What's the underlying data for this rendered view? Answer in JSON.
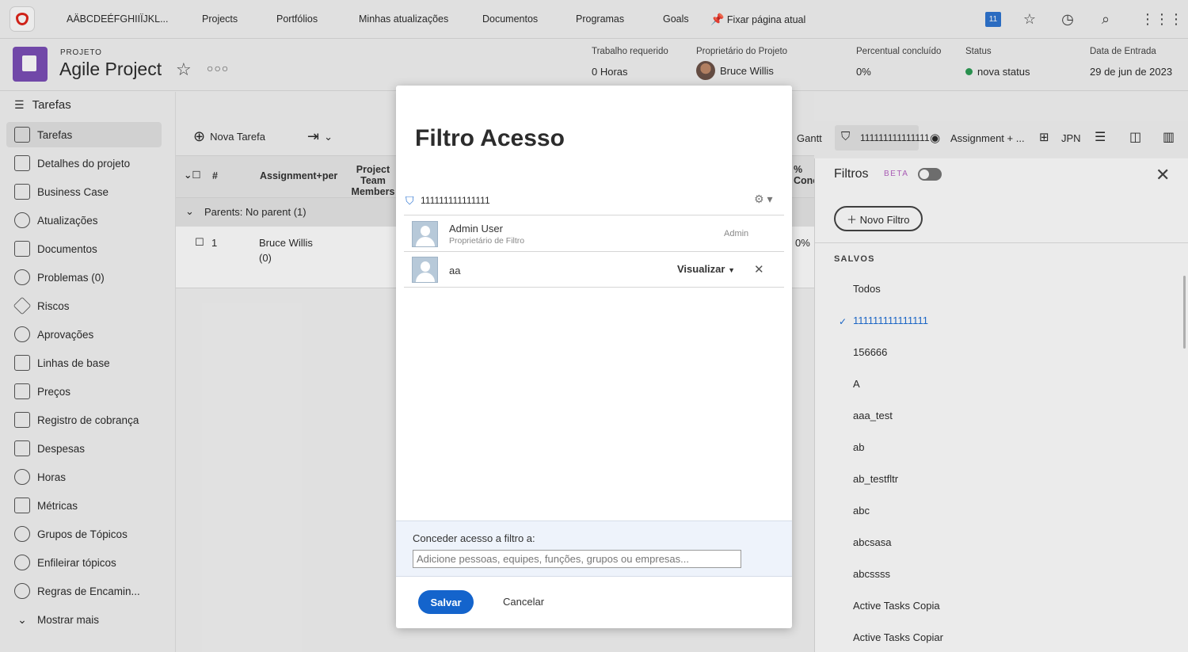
{
  "topnav": {
    "account": "AÄBCDEÉFGHIIÏJKL...",
    "items": [
      "Projects",
      "Portfólios",
      "Minhas atualizações",
      "Documentos",
      "Programas",
      "Goals"
    ],
    "pin_label": "Fixar página atual",
    "notification_count": "11"
  },
  "project": {
    "kicker": "PROJETO",
    "title": "Agile Project",
    "meta": [
      {
        "label": "Trabalho requerido",
        "value": "0 Horas"
      },
      {
        "label": "Proprietário do Projeto",
        "value": "Bruce Willis"
      },
      {
        "label": "Percentual concluído",
        "value": "0%"
      },
      {
        "label": "Status",
        "value": "nova status"
      },
      {
        "label": "Data de Entrada",
        "value": "29 de jun de 2023"
      }
    ]
  },
  "sidebar": {
    "header": "Tarefas",
    "items": [
      "Tarefas",
      "Detalhes do projeto",
      "Business Case",
      "Atualizações",
      "Documentos",
      "Problemas (0)",
      "Riscos",
      "Aprovações",
      "Linhas de base",
      "Preços",
      "Registro de cobrança",
      "Despesas",
      "Horas",
      "Métricas",
      "Grupos de Tópicos",
      "Enfileirar tópicos",
      "Regras de Encamin...",
      "Mostrar mais"
    ]
  },
  "main": {
    "new_task": "Nova Tarefa",
    "gantt": "Gantt",
    "filter_name": "111111111111111",
    "view_name": "Assignment + ...",
    "grouping": "JPN",
    "columns": [
      "#",
      "Assignment+per",
      "Project Team Members"
    ],
    "column_partial": "% Conc",
    "group_row": "Parents: No parent (1)",
    "row": {
      "num": "1",
      "assignee": "Bruce Willis",
      "count": "(0)",
      "percent": "0%"
    }
  },
  "filters_panel": {
    "title": "Filtros",
    "beta": "BETA",
    "new_filter": "Novo Filtro",
    "saved_header": "SALVOS",
    "saved": [
      "Todos",
      "111111111111111",
      "156666",
      "A",
      "aaa_test",
      "ab",
      "ab_testfltr",
      "abc",
      "abcsasa",
      "abcssss",
      "Active Tasks Copia",
      "Active Tasks Copiar"
    ],
    "selected_index": 1
  },
  "modal": {
    "title": "Filtro Acesso",
    "filter_name": "111111111111111",
    "users": [
      {
        "name": "Admin User",
        "subtitle": "Proprietário de Filtro",
        "role": "Admin"
      },
      {
        "name": "aa",
        "permission": "Visualizar"
      }
    ],
    "grant_label": "Conceder acesso a filtro a:",
    "grant_placeholder": "Adicione pessoas, equipes, funções, grupos ou empresas...",
    "save": "Salvar",
    "cancel": "Cancelar"
  }
}
